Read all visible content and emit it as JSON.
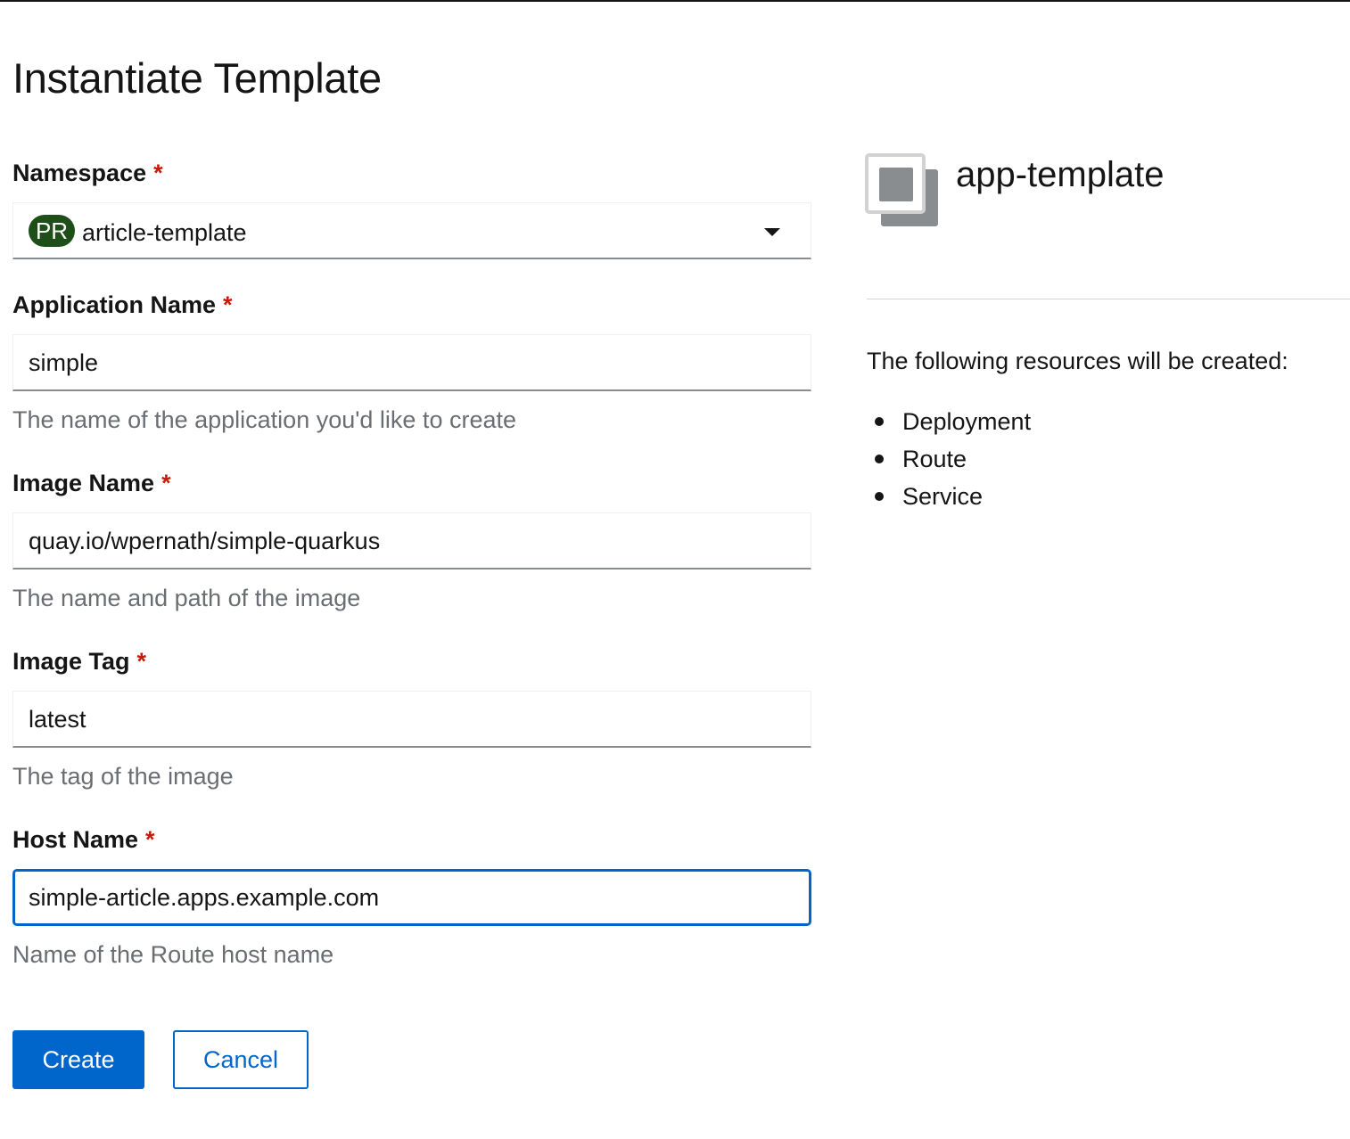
{
  "page": {
    "title": "Instantiate Template"
  },
  "form": {
    "required_marker": "*",
    "namespace": {
      "label": "Namespace",
      "badge": "PR",
      "value": "article-template"
    },
    "application_name": {
      "label": "Application Name",
      "value": "simple",
      "helper": "The name of the application you'd like to create"
    },
    "image_name": {
      "label": "Image Name",
      "value": "quay.io/wpernath/simple-quarkus",
      "helper": "The name and path of the image"
    },
    "image_tag": {
      "label": "Image Tag",
      "value": "latest",
      "helper": "The tag of the image"
    },
    "host_name": {
      "label": "Host Name",
      "value": "simple-article.apps.example.com",
      "helper": "Name of the Route host name"
    }
  },
  "actions": {
    "create_label": "Create",
    "cancel_label": "Cancel"
  },
  "template_panel": {
    "icon": "template-icon",
    "title": "app-template",
    "intro": "The following resources will be created:",
    "resources": [
      "Deployment",
      "Route",
      "Service"
    ]
  },
  "colors": {
    "primary": "#0066cc",
    "required": "#c9190b",
    "badge_bg": "#1e4f18",
    "helper_text": "#6a6e73"
  }
}
